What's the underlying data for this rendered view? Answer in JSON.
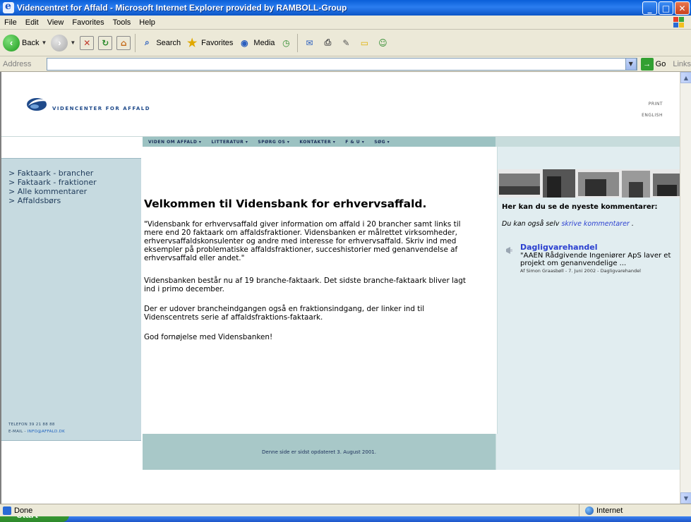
{
  "window": {
    "title": "Videncentret for Affald - Microsoft Internet Explorer provided by RAMBOLL-Group",
    "buttons": [
      "_",
      "□",
      "✕"
    ]
  },
  "menubar": {
    "items": [
      "File",
      "Edit",
      "View",
      "Favorites",
      "Tools",
      "Help"
    ]
  },
  "toolbar": {
    "back_label": "Back",
    "search_label": "Search",
    "favorites_label": "Favorites",
    "media_label": "Media"
  },
  "addressbar": {
    "label": "Address",
    "value": "",
    "go_label": "Go",
    "links_label": "Links"
  },
  "site": {
    "logo_text": "VIDENCENTER FOR AFFALD",
    "header_links": [
      "PRINT",
      "ENGLISH"
    ],
    "nav": [
      "VIDEN OM AFFALD ▾",
      "LITTERATUR ▾",
      "SPØRG OS ▾",
      "KONTAKTER ▾",
      "F & U ▾",
      "SØG ▾"
    ],
    "sidebar": {
      "links": [
        "> Faktaark - brancher",
        "> Faktaark - fraktioner",
        "> Alle kommentarer",
        "> Affaldsbørs"
      ],
      "contact_phone": "TELEFON  39 21 88 88",
      "contact_email_label": "E-MAIL",
      "contact_email": "INFO@AFFALD.DK"
    },
    "main": {
      "title": "Velkommen til Vidensbank for erhvervsaffald.",
      "paragraphs": [
        "\"Vidensbank for erhvervsaffald giver information om affald i 20 brancher samt links til mere end 20 faktaark om affaldsfraktioner. Vidensbanken er målrettet virksomheder, erhvervsaffaldskonsulenter og andre med interesse for erhvervsaffald. Skriv ind med eksempler på problematiske affaldsfraktioner, succeshistorier med genanvendelse af erhvervsaffald eller andet.\"",
        "Vidensbanken består nu af 19 branche-faktaark. Det sidste branche-faktaark bliver lagt ind i primo december.",
        "Der er udover brancheindgangen også en fraktionsindgang, der linker ind til Videnscentrets serie af affaldsfraktions-faktaark.",
        "God fornøjelse med Vidensbanken!"
      ]
    },
    "right": {
      "heading": "Her kan du se de nyeste kommentarer:",
      "sub_prefix": "Du kan også selv",
      "sub_link": "skrive kommentarer",
      "sub_suffix": ".",
      "comment": {
        "title": "Dagligvarehandel",
        "text": "\"AAEN Rådgivende Ingeniører ApS laver et projekt om genanvendelige ...",
        "meta": "Af Simon Graasbøll - 7. Juni 2002 - Dagligvarehandel"
      }
    },
    "footer": "Denne side er sidst opdateret 3. August 2001."
  },
  "status": {
    "left": "Done",
    "zone": "Internet"
  },
  "taskbar": {
    "start": "start"
  },
  "colors": {
    "titlebar": "#0a5fd8",
    "nav_band": "#9cc2c2",
    "sidebar": "#c6dae0",
    "right_col": "#e1edf0",
    "footer_band": "#a8c8c8",
    "link": "#2a3fd0"
  }
}
